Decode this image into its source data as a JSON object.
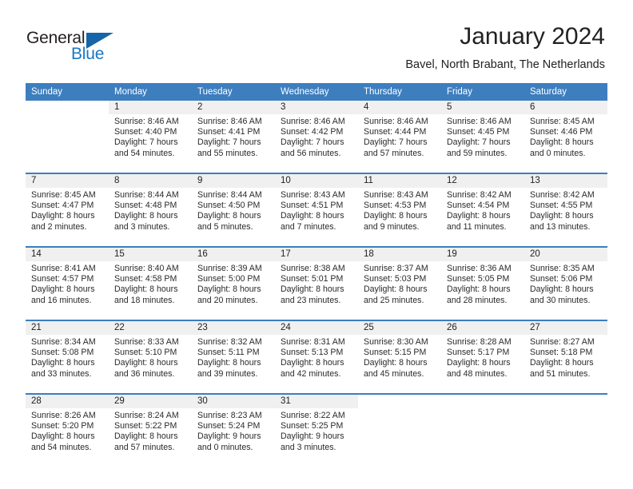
{
  "brand": {
    "name_part1": "General",
    "name_part2": "Blue",
    "triangle_color": "#1565a8",
    "blue_color": "#1b77c0"
  },
  "header": {
    "title": "January 2024",
    "subtitle": "Bavel, North Brabant, The Netherlands"
  },
  "theme": {
    "header_blue": "#3d7ebf",
    "daynum_strip_gray": "#f0f0f0",
    "text": "#222222"
  },
  "weekdays": [
    "Sunday",
    "Monday",
    "Tuesday",
    "Wednesday",
    "Thursday",
    "Friday",
    "Saturday"
  ],
  "weeks": [
    [
      {
        "day": "",
        "sunrise": "",
        "sunset": "",
        "daylight": "",
        "blank": true
      },
      {
        "day": "1",
        "sunrise": "Sunrise: 8:46 AM",
        "sunset": "Sunset: 4:40 PM",
        "daylight": "Daylight: 7 hours and 54 minutes."
      },
      {
        "day": "2",
        "sunrise": "Sunrise: 8:46 AM",
        "sunset": "Sunset: 4:41 PM",
        "daylight": "Daylight: 7 hours and 55 minutes."
      },
      {
        "day": "3",
        "sunrise": "Sunrise: 8:46 AM",
        "sunset": "Sunset: 4:42 PM",
        "daylight": "Daylight: 7 hours and 56 minutes."
      },
      {
        "day": "4",
        "sunrise": "Sunrise: 8:46 AM",
        "sunset": "Sunset: 4:44 PM",
        "daylight": "Daylight: 7 hours and 57 minutes."
      },
      {
        "day": "5",
        "sunrise": "Sunrise: 8:46 AM",
        "sunset": "Sunset: 4:45 PM",
        "daylight": "Daylight: 7 hours and 59 minutes."
      },
      {
        "day": "6",
        "sunrise": "Sunrise: 8:45 AM",
        "sunset": "Sunset: 4:46 PM",
        "daylight": "Daylight: 8 hours and 0 minutes."
      }
    ],
    [
      {
        "day": "7",
        "sunrise": "Sunrise: 8:45 AM",
        "sunset": "Sunset: 4:47 PM",
        "daylight": "Daylight: 8 hours and 2 minutes."
      },
      {
        "day": "8",
        "sunrise": "Sunrise: 8:44 AM",
        "sunset": "Sunset: 4:48 PM",
        "daylight": "Daylight: 8 hours and 3 minutes."
      },
      {
        "day": "9",
        "sunrise": "Sunrise: 8:44 AM",
        "sunset": "Sunset: 4:50 PM",
        "daylight": "Daylight: 8 hours and 5 minutes."
      },
      {
        "day": "10",
        "sunrise": "Sunrise: 8:43 AM",
        "sunset": "Sunset: 4:51 PM",
        "daylight": "Daylight: 8 hours and 7 minutes."
      },
      {
        "day": "11",
        "sunrise": "Sunrise: 8:43 AM",
        "sunset": "Sunset: 4:53 PM",
        "daylight": "Daylight: 8 hours and 9 minutes."
      },
      {
        "day": "12",
        "sunrise": "Sunrise: 8:42 AM",
        "sunset": "Sunset: 4:54 PM",
        "daylight": "Daylight: 8 hours and 11 minutes."
      },
      {
        "day": "13",
        "sunrise": "Sunrise: 8:42 AM",
        "sunset": "Sunset: 4:55 PM",
        "daylight": "Daylight: 8 hours and 13 minutes."
      }
    ],
    [
      {
        "day": "14",
        "sunrise": "Sunrise: 8:41 AM",
        "sunset": "Sunset: 4:57 PM",
        "daylight": "Daylight: 8 hours and 16 minutes."
      },
      {
        "day": "15",
        "sunrise": "Sunrise: 8:40 AM",
        "sunset": "Sunset: 4:58 PM",
        "daylight": "Daylight: 8 hours and 18 minutes."
      },
      {
        "day": "16",
        "sunrise": "Sunrise: 8:39 AM",
        "sunset": "Sunset: 5:00 PM",
        "daylight": "Daylight: 8 hours and 20 minutes."
      },
      {
        "day": "17",
        "sunrise": "Sunrise: 8:38 AM",
        "sunset": "Sunset: 5:01 PM",
        "daylight": "Daylight: 8 hours and 23 minutes."
      },
      {
        "day": "18",
        "sunrise": "Sunrise: 8:37 AM",
        "sunset": "Sunset: 5:03 PM",
        "daylight": "Daylight: 8 hours and 25 minutes."
      },
      {
        "day": "19",
        "sunrise": "Sunrise: 8:36 AM",
        "sunset": "Sunset: 5:05 PM",
        "daylight": "Daylight: 8 hours and 28 minutes."
      },
      {
        "day": "20",
        "sunrise": "Sunrise: 8:35 AM",
        "sunset": "Sunset: 5:06 PM",
        "daylight": "Daylight: 8 hours and 30 minutes."
      }
    ],
    [
      {
        "day": "21",
        "sunrise": "Sunrise: 8:34 AM",
        "sunset": "Sunset: 5:08 PM",
        "daylight": "Daylight: 8 hours and 33 minutes."
      },
      {
        "day": "22",
        "sunrise": "Sunrise: 8:33 AM",
        "sunset": "Sunset: 5:10 PM",
        "daylight": "Daylight: 8 hours and 36 minutes."
      },
      {
        "day": "23",
        "sunrise": "Sunrise: 8:32 AM",
        "sunset": "Sunset: 5:11 PM",
        "daylight": "Daylight: 8 hours and 39 minutes."
      },
      {
        "day": "24",
        "sunrise": "Sunrise: 8:31 AM",
        "sunset": "Sunset: 5:13 PM",
        "daylight": "Daylight: 8 hours and 42 minutes."
      },
      {
        "day": "25",
        "sunrise": "Sunrise: 8:30 AM",
        "sunset": "Sunset: 5:15 PM",
        "daylight": "Daylight: 8 hours and 45 minutes."
      },
      {
        "day": "26",
        "sunrise": "Sunrise: 8:28 AM",
        "sunset": "Sunset: 5:17 PM",
        "daylight": "Daylight: 8 hours and 48 minutes."
      },
      {
        "day": "27",
        "sunrise": "Sunrise: 8:27 AM",
        "sunset": "Sunset: 5:18 PM",
        "daylight": "Daylight: 8 hours and 51 minutes."
      }
    ],
    [
      {
        "day": "28",
        "sunrise": "Sunrise: 8:26 AM",
        "sunset": "Sunset: 5:20 PM",
        "daylight": "Daylight: 8 hours and 54 minutes."
      },
      {
        "day": "29",
        "sunrise": "Sunrise: 8:24 AM",
        "sunset": "Sunset: 5:22 PM",
        "daylight": "Daylight: 8 hours and 57 minutes."
      },
      {
        "day": "30",
        "sunrise": "Sunrise: 8:23 AM",
        "sunset": "Sunset: 5:24 PM",
        "daylight": "Daylight: 9 hours and 0 minutes."
      },
      {
        "day": "31",
        "sunrise": "Sunrise: 8:22 AM",
        "sunset": "Sunset: 5:25 PM",
        "daylight": "Daylight: 9 hours and 3 minutes."
      },
      {
        "day": "",
        "sunrise": "",
        "sunset": "",
        "daylight": "",
        "blank": true
      },
      {
        "day": "",
        "sunrise": "",
        "sunset": "",
        "daylight": "",
        "blank": true
      },
      {
        "day": "",
        "sunrise": "",
        "sunset": "",
        "daylight": "",
        "blank": true
      }
    ]
  ]
}
